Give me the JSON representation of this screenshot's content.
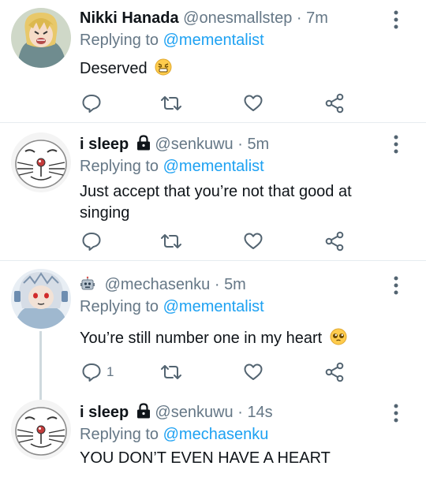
{
  "tweets": [
    {
      "name": "Nikki Hanada",
      "handle": "@onesmallstep",
      "time": "7m",
      "replying_prefix": "Replying to",
      "replying_to": "@mementalist",
      "text": "Deserved",
      "reply_count": "",
      "avatar_icon": "anime-character-avatar",
      "emoji_icon": "persevering-face-emoji"
    },
    {
      "name": "i sleep",
      "handle": "@senkuwu",
      "time": "5m",
      "replying_prefix": "Replying to",
      "replying_to": "@mementalist",
      "text": "Just accept that you’re not that good at singing",
      "reply_count": "",
      "avatar_icon": "doraemon-face-avatar",
      "badge_icon": "lock-icon"
    },
    {
      "name": "",
      "handle": "@mechasenku",
      "time": "5m",
      "replying_prefix": "Replying to",
      "replying_to": "@mementalist",
      "text": "You’re still number one in my heart",
      "reply_count": "1",
      "avatar_icon": "robot-anime-avatar",
      "badge_icon": "robot-emoji",
      "emoji_icon": "pleading-face-emoji"
    },
    {
      "name": "i sleep",
      "handle": "@senkuwu",
      "time": "14s",
      "replying_prefix": "Replying to",
      "replying_to": "@mechasenku",
      "text": "YOU DON’T EVEN HAVE A HEART",
      "reply_count": "",
      "avatar_icon": "doraemon-face-avatar",
      "badge_icon": "lock-icon"
    }
  ],
  "separator": "·",
  "colors": {
    "text": "#0f1419",
    "muted": "#657786",
    "link": "#1da1f2",
    "divider": "#e6ecf0"
  }
}
